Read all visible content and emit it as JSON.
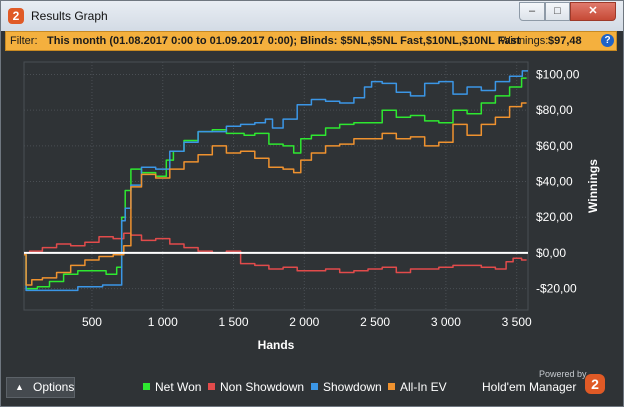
{
  "window": {
    "title": "Results Graph",
    "app_icon": "2",
    "minimize_icon": "minimize-icon",
    "maximize_icon": "maximize-icon",
    "close_icon": "close-icon"
  },
  "filter": {
    "label": "Filter:",
    "text": "This month (01.08.2017 0:00 to 01.09.2017 0:00); Blinds: $5NL,$5NL Fast,$10NL,$10NL Fast",
    "winnings_label": "Winnings:",
    "winnings_value": "$97,48",
    "help_icon": "?"
  },
  "footer": {
    "options_label": "Options",
    "options_icon": "^",
    "powered_by": "Powered by",
    "brand": "Hold'em Manager",
    "brand_logo": "2"
  },
  "chart_data": {
    "type": "line",
    "xlabel": "Hands",
    "ylabel": "Winnings",
    "xlim": [
      20,
      3580
    ],
    "ylim": [
      -32,
      107
    ],
    "x_ticks": [
      500,
      1000,
      1500,
      2000,
      2500,
      3000,
      3500
    ],
    "x_tick_labels": [
      "500",
      "1 000",
      "1 500",
      "2 000",
      "2 500",
      "3 000",
      "3 500"
    ],
    "y_ticks": [
      100,
      80,
      60,
      40,
      20,
      0,
      -20
    ],
    "y_tick_labels": [
      "$100,00",
      "$80,00",
      "$60,00",
      "$40,00",
      "$20,00",
      "$0,00",
      "-$20,00"
    ],
    "zero_line": true,
    "legend_position": "bottom",
    "colors": {
      "background": "#2f3336",
      "grid": "#4a4f54",
      "zero": "#ffffff",
      "accent": "#f4b03e"
    },
    "series": [
      {
        "name": "Net Won",
        "color": "#2ee830",
        "x": [
          20,
          50,
          80,
          150,
          250,
          350,
          450,
          550,
          650,
          700,
          720,
          750,
          800,
          900,
          1000,
          1050,
          1100,
          1200,
          1300,
          1400,
          1500,
          1550,
          1600,
          1700,
          1800,
          1900,
          1950,
          2000,
          2100,
          2200,
          2300,
          2400,
          2500,
          2600,
          2700,
          2800,
          2900,
          3000,
          3100,
          3200,
          3300,
          3400,
          3500,
          3570
        ],
        "y": [
          -1,
          -20,
          -20,
          -19,
          -16,
          -12,
          -10,
          -10,
          -12,
          -8,
          20,
          35,
          47,
          45,
          43,
          52,
          57,
          63,
          68,
          69,
          67,
          67,
          66,
          67,
          61,
          60,
          56,
          64,
          66,
          70,
          72,
          73,
          73,
          80,
          76,
          77,
          74,
          73,
          80,
          78,
          84,
          88,
          93,
          98
        ]
      },
      {
        "name": "Non Showdown",
        "color": "#e24b4b",
        "x": [
          20,
          100,
          200,
          300,
          400,
          500,
          600,
          700,
          750,
          800,
          900,
          1000,
          1100,
          1200,
          1300,
          1400,
          1500,
          1600,
          1700,
          1800,
          1900,
          2000,
          2100,
          2200,
          2300,
          2400,
          2500,
          2600,
          2700,
          2800,
          2900,
          3000,
          3100,
          3200,
          3300,
          3400,
          3450,
          3500,
          3570
        ],
        "y": [
          0,
          1,
          3,
          5,
          4,
          6,
          9,
          8,
          11,
          10,
          7,
          8,
          5,
          3,
          1,
          0,
          1,
          -6,
          -7,
          -9,
          -8,
          -10,
          -10,
          -9,
          -11,
          -10,
          -9,
          -8,
          -11,
          -9,
          -9,
          -8,
          -7,
          -7,
          -8,
          -9,
          -5,
          -3,
          -4
        ]
      },
      {
        "name": "Showdown",
        "color": "#3b96e6",
        "x": [
          20,
          50,
          100,
          300,
          500,
          650,
          700,
          720,
          750,
          800,
          900,
          1000,
          1100,
          1200,
          1300,
          1400,
          1500,
          1600,
          1700,
          1750,
          1800,
          1900,
          2000,
          2100,
          2200,
          2300,
          2400,
          2450,
          2500,
          2600,
          2700,
          2800,
          2900,
          3000,
          3100,
          3200,
          3300,
          3400,
          3500,
          3580
        ],
        "y": [
          -1,
          -21,
          -21,
          -21,
          -19,
          -18,
          -18,
          18,
          25,
          38,
          48,
          47,
          57,
          62,
          68,
          68,
          71,
          72,
          73,
          75,
          70,
          75,
          83,
          86,
          85,
          84,
          87,
          93,
          96,
          95,
          90,
          88,
          95,
          96,
          89,
          93,
          91,
          96,
          99,
          102
        ]
      },
      {
        "name": "All-In EV",
        "color": "#ef922f",
        "x": [
          20,
          50,
          100,
          200,
          300,
          400,
          500,
          600,
          700,
          750,
          800,
          900,
          1000,
          1100,
          1200,
          1300,
          1400,
          1500,
          1600,
          1700,
          1800,
          1900,
          1950,
          2000,
          2100,
          2200,
          2300,
          2400,
          2500,
          2600,
          2700,
          2800,
          2900,
          3000,
          3100,
          3200,
          3300,
          3400,
          3500,
          3570
        ],
        "y": [
          -1,
          -18,
          -15,
          -14,
          -11,
          -7,
          -4,
          -2,
          -1,
          4,
          37,
          44,
          42,
          47,
          51,
          55,
          60,
          56,
          57,
          53,
          48,
          47,
          45,
          52,
          56,
          60,
          61,
          64,
          64,
          67,
          64,
          65,
          60,
          62,
          72,
          66,
          72,
          76,
          82,
          84
        ]
      }
    ]
  }
}
